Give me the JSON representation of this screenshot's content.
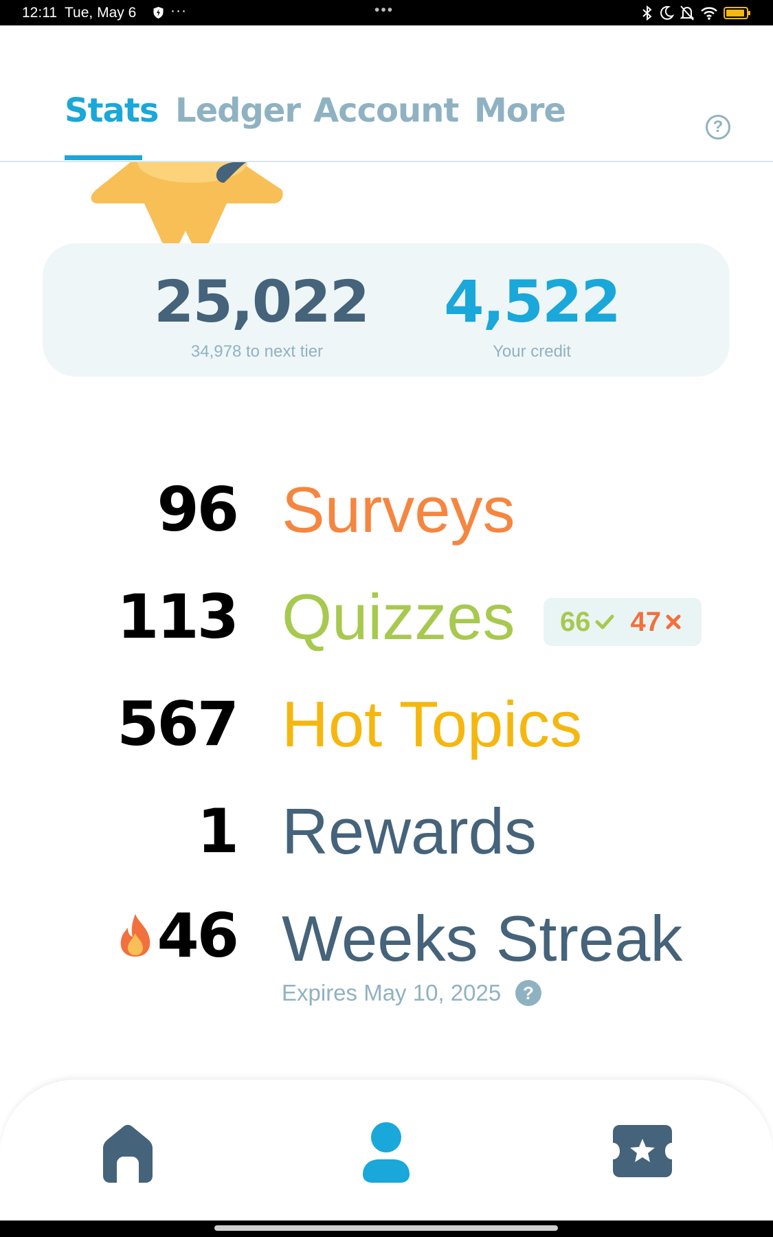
{
  "status_bar": {
    "time": "12:11",
    "date": "Tue, May 6",
    "more": "···",
    "center": "•••"
  },
  "tabs": [
    {
      "label": "Stats",
      "active": true
    },
    {
      "label": "Ledger",
      "active": false
    },
    {
      "label": "Account",
      "active": false
    },
    {
      "label": "More",
      "active": false
    }
  ],
  "help_icon": "?",
  "summary": {
    "points": "25,022",
    "points_sub": "34,978 to next tier",
    "credit": "4,522",
    "credit_sub": "Your credit"
  },
  "stats": {
    "surveys": {
      "count": "96",
      "label": "Surveys"
    },
    "quizzes": {
      "count": "113",
      "label": "Quizzes",
      "correct": "66",
      "wrong": "47"
    },
    "hot_topics": {
      "count": "567",
      "label": "Hot Topics"
    },
    "rewards": {
      "count": "1",
      "label": "Rewards"
    },
    "streak": {
      "count": "46",
      "label": "Weeks Streak",
      "expires": "Expires May 10, 2025"
    }
  },
  "expires_help_icon": "?",
  "colors": {
    "accent": "#1aa7d9",
    "surveys": "#f58640",
    "quizzes": "#a7c94f",
    "hot_topics": "#f5b70f",
    "slate": "#45637a",
    "muted": "#8fb2c2"
  },
  "bottom_nav": [
    {
      "icon": "home-icon",
      "active": false
    },
    {
      "icon": "profile-icon",
      "active": true
    },
    {
      "icon": "rewards-ticket-icon",
      "active": false
    }
  ]
}
